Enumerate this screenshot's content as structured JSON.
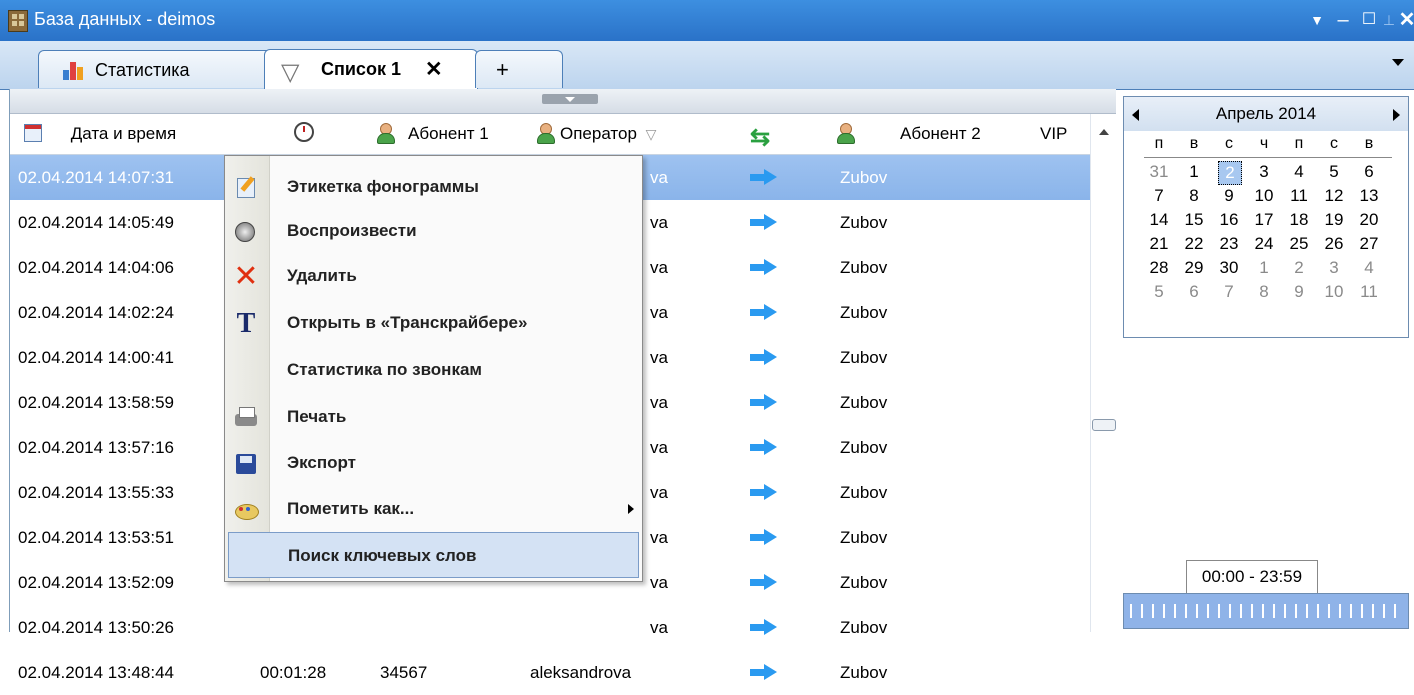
{
  "window": {
    "title": "База данных - deimos"
  },
  "tabs": [
    {
      "label": "Статистика"
    },
    {
      "label": "Список 1",
      "close": "✕"
    },
    {
      "label": "+"
    }
  ],
  "columns": {
    "datetime": "Дата и время",
    "subscriber1": "Абонент 1",
    "operator": "Оператор",
    "subscriber2": "Абонент 2",
    "vip": "VIP"
  },
  "rows": [
    {
      "datetime": "02.04.2014 14:07:31",
      "operator": "va",
      "subscriber2": "Zubov",
      "selected": true
    },
    {
      "datetime": "02.04.2014 14:05:49",
      "operator": "va",
      "subscriber2": "Zubov"
    },
    {
      "datetime": "02.04.2014 14:04:06",
      "operator": "va",
      "subscriber2": "Zubov"
    },
    {
      "datetime": "02.04.2014 14:02:24",
      "operator": "va",
      "subscriber2": "Zubov"
    },
    {
      "datetime": "02.04.2014 14:00:41",
      "operator": "va",
      "subscriber2": "Zubov"
    },
    {
      "datetime": "02.04.2014 13:58:59",
      "operator": "va",
      "subscriber2": "Zubov"
    },
    {
      "datetime": "02.04.2014 13:57:16",
      "operator": "va",
      "subscriber2": "Zubov"
    },
    {
      "datetime": "02.04.2014 13:55:33",
      "operator": "va",
      "subscriber2": "Zubov"
    },
    {
      "datetime": "02.04.2014 13:53:51",
      "operator": "va",
      "subscriber2": "Zubov"
    },
    {
      "datetime": "02.04.2014 13:52:09",
      "operator": "va",
      "subscriber2": "Zubov"
    },
    {
      "datetime": "02.04.2014 13:50:26",
      "operator": "va",
      "subscriber2": "Zubov"
    },
    {
      "datetime": "02.04.2014 13:48:44",
      "duration": "00:01:28",
      "subscriber1": "34567",
      "operator": "aleksandrova",
      "subscriber2": "Zubov"
    }
  ],
  "context_menu": [
    {
      "label": "Этикетка фонограммы",
      "icon": "label-edit-icon"
    },
    {
      "label": "Воспроизвести",
      "icon": "speaker-icon"
    },
    {
      "label": "Удалить",
      "icon": "delete-x-icon"
    },
    {
      "label": "Открыть в «Транскрайбере»",
      "icon": "transcriber-t-icon"
    },
    {
      "label": "Статистика по звонкам",
      "icon": ""
    },
    {
      "label": "Печать",
      "icon": "printer-icon"
    },
    {
      "label": "Экспорт",
      "icon": "export-disk-icon"
    },
    {
      "label": "Пометить как...",
      "icon": "palette-icon",
      "submenu": true
    },
    {
      "label": "Поиск ключевых слов",
      "icon": "",
      "highlighted": true
    }
  ],
  "calendar": {
    "month": "Апрель 2014",
    "weekdays": [
      "п",
      "в",
      "с",
      "ч",
      "п",
      "с",
      "в"
    ],
    "weeks": [
      [
        "31",
        "1",
        "2",
        "3",
        "4",
        "5",
        "6"
      ],
      [
        "7",
        "8",
        "9",
        "10",
        "11",
        "12",
        "13"
      ],
      [
        "14",
        "15",
        "16",
        "17",
        "18",
        "19",
        "20"
      ],
      [
        "21",
        "22",
        "23",
        "24",
        "25",
        "26",
        "27"
      ],
      [
        "28",
        "29",
        "30",
        "1",
        "2",
        "3",
        "4"
      ],
      [
        "5",
        "6",
        "7",
        "8",
        "9",
        "10",
        "11"
      ]
    ],
    "selected_day": "2"
  },
  "time_range": "00:00 - 23:59",
  "colors": {
    "title_bar": "#2a72c8",
    "selection": "#8ab4ea",
    "direction_arrow": "#2a9af0"
  }
}
